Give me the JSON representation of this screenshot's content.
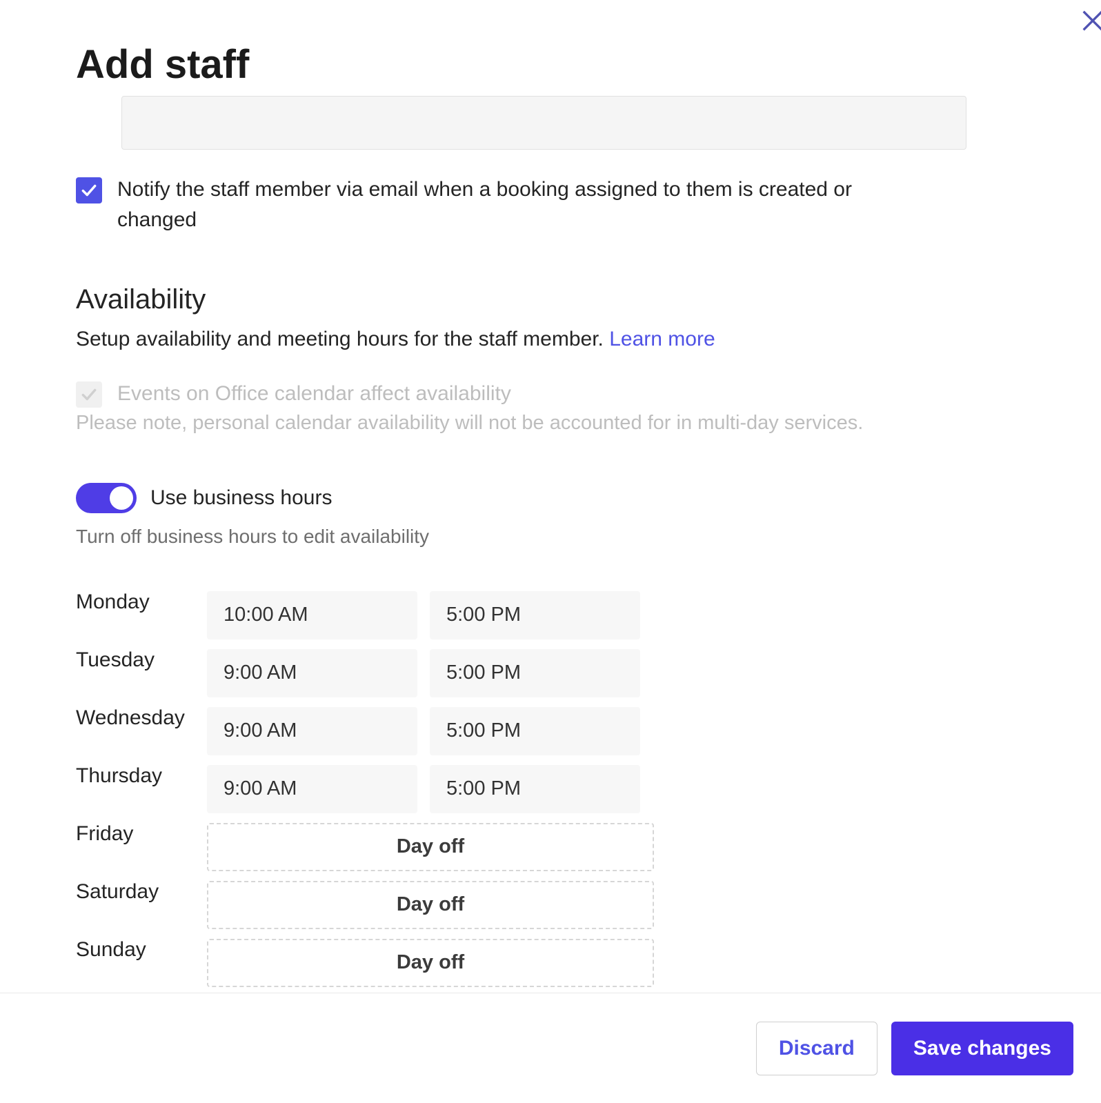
{
  "header": {
    "title": "Add staff"
  },
  "notify": {
    "checked": true,
    "label": "Notify the staff member via email when a booking assigned to them is created or changed"
  },
  "availability": {
    "heading": "Availability",
    "sub_text": "Setup availability and meeting hours for the staff member.",
    "learn_more": "Learn more",
    "events_checkbox": {
      "checked": true,
      "disabled": true,
      "label": "Events on Office calendar affect availability"
    },
    "events_note": "Please note, personal calendar availability will not be accounted for in multi-day services.",
    "use_business_hours": {
      "on": true,
      "label": "Use business hours"
    },
    "business_hours_note": "Turn off business hours to edit availability",
    "day_off_label": "Day off",
    "schedule": [
      {
        "day": "Monday",
        "start": "10:00 AM",
        "end": "5:00 PM",
        "off": false
      },
      {
        "day": "Tuesday",
        "start": "9:00 AM",
        "end": "5:00 PM",
        "off": false
      },
      {
        "day": "Wednesday",
        "start": "9:00 AM",
        "end": "5:00 PM",
        "off": false
      },
      {
        "day": "Thursday",
        "start": "9:00 AM",
        "end": "5:00 PM",
        "off": false
      },
      {
        "day": "Friday",
        "start": "",
        "end": "",
        "off": true
      },
      {
        "day": "Saturday",
        "start": "",
        "end": "",
        "off": true
      },
      {
        "day": "Sunday",
        "start": "",
        "end": "",
        "off": true
      }
    ]
  },
  "footer": {
    "discard": "Discard",
    "save": "Save changes"
  }
}
